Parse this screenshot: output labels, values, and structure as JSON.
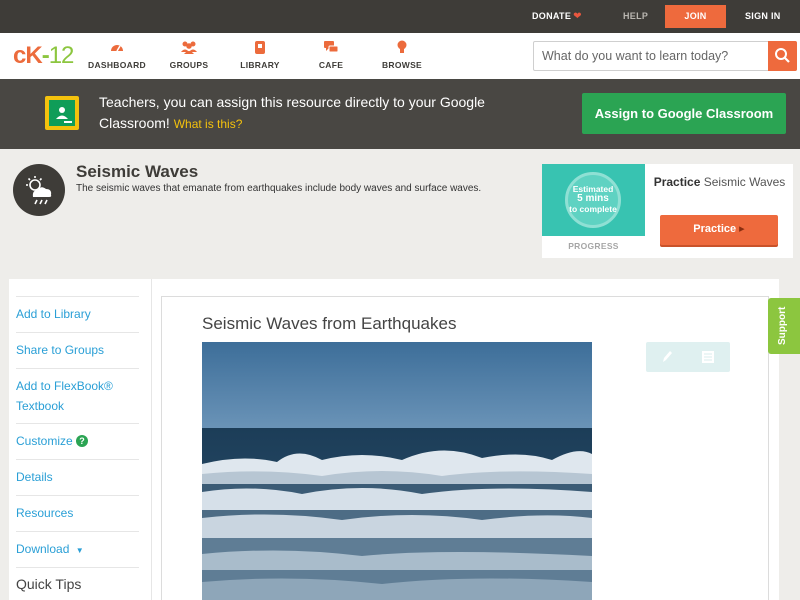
{
  "topbar": {
    "donate": "DONATE",
    "help": "HELP",
    "join": "JOIN",
    "sign_in": "SIGN IN"
  },
  "nav": {
    "logo_prefix": "cK",
    "logo_number": "12",
    "items": [
      {
        "label": "DASHBOARD",
        "icon": "dashboard-icon"
      },
      {
        "label": "GROUPS",
        "icon": "groups-icon"
      },
      {
        "label": "LIBRARY",
        "icon": "library-icon"
      },
      {
        "label": "CAFE",
        "icon": "cafe-icon"
      },
      {
        "label": "BROWSE",
        "icon": "browse-icon"
      }
    ],
    "search_placeholder": "What do you want to learn today?"
  },
  "banner": {
    "text": "Teachers, you can assign this resource directly to your Google Classroom!",
    "what_is_this": "What is this?",
    "assign_button": "Assign to Google Classroom"
  },
  "concept": {
    "title": "Seismic Waves",
    "description": "The seismic waves that emanate from earthquakes include body waves and surface waves.",
    "icon": "weather-cloud-sun-icon"
  },
  "practice": {
    "estimate_line1": "Estimated",
    "estimate_line2": "5 mins",
    "estimate_line3": "to complete",
    "progress_label": "PROGRESS",
    "practice_prefix": "Practice",
    "practice_topic": "Seismic Waves",
    "practice_button": "Practice"
  },
  "sidebar": {
    "items": [
      {
        "label": "Add to Library"
      },
      {
        "label": "Share to Groups"
      },
      {
        "label": "Add to FlexBook® Textbook"
      },
      {
        "label": "Customize"
      },
      {
        "label": "Details"
      },
      {
        "label": "Resources"
      },
      {
        "label": "Download"
      }
    ],
    "quick_tips": "Quick Tips"
  },
  "content": {
    "title": "Seismic Waves from Earthquakes",
    "image_alt": "ocean waves breaking"
  },
  "support_tab": "Support",
  "colors": {
    "brand_orange": "#ee6a3d",
    "brand_green": "#8cc63f",
    "classroom_green": "#2ba453",
    "link_blue": "#2a9fd6"
  }
}
